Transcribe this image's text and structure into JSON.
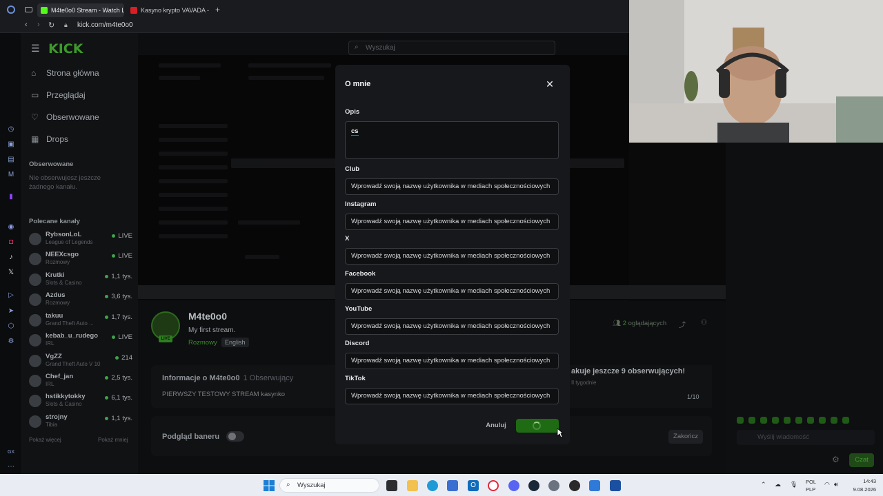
{
  "browser": {
    "tabs": [
      {
        "title": "M4te0o0 Stream - Watch L",
        "active": true,
        "icon_color": "#53fc18"
      },
      {
        "title": "Kasyno krypto VAVADA - i",
        "active": false,
        "icon_color": "#d81f26"
      }
    ],
    "url": "kick.com/m4te0o0"
  },
  "kick": {
    "logo": "KICK",
    "search_placeholder": "Wyszukaj",
    "nav": [
      {
        "label": "Strona główna",
        "icon": "home-icon"
      },
      {
        "label": "Przeglądaj",
        "icon": "browse-icon"
      },
      {
        "label": "Obserwowane",
        "icon": "heart-icon"
      },
      {
        "label": "Drops",
        "icon": "drops-icon"
      }
    ],
    "followed_title": "Obserwowane",
    "followed_empty": "Nie obserwujesz jeszcze żadnego kanału.",
    "recommended_title": "Polecane kanały",
    "recommended": [
      {
        "name": "RybsonLoL",
        "game": "League of Legends",
        "viewers": "LIVE"
      },
      {
        "name": "NEEXcsgo",
        "game": "Rozmowy",
        "viewers": "LIVE"
      },
      {
        "name": "Krutki",
        "game": "Slots & Casino",
        "viewers": "1,1 tys."
      },
      {
        "name": "Azdus",
        "game": "Rozmowy",
        "viewers": "3,6 tys."
      },
      {
        "name": "takuu",
        "game": "Grand Theft Auto ...",
        "viewers": "1,7 tys."
      },
      {
        "name": "kebab_u_rudego",
        "game": "IRL",
        "viewers": "LIVE"
      },
      {
        "name": "VgZZ",
        "game": "Grand Theft Auto V 10",
        "viewers": "214"
      },
      {
        "name": "Chef_jan",
        "game": "IRL",
        "viewers": "2,5 tys."
      },
      {
        "name": "hstikkytokky",
        "game": "Slots & Casino",
        "viewers": "6,1 tys."
      },
      {
        "name": "strojny",
        "game": "Tibia",
        "viewers": "1,1 tys."
      }
    ],
    "show_more": "Pokaż więcej",
    "show_less": "Pokaż mniej",
    "channel": {
      "name": "M4te0o0",
      "title": "My first stream.",
      "category": "Rozmowy",
      "language": "English",
      "live_badge": "LIVE",
      "viewers_count": "2",
      "viewers_label": "oglądających"
    },
    "about": {
      "title": "Informacje o M4te0o0",
      "followers": "1 Obserwujący",
      "description": "PIERWSZY TESTOWY STREAM kasynko"
    },
    "goal": {
      "title": "akuje jeszcze 9 obserwujących!",
      "subtitle": "Il tygodnie",
      "count": "1/10"
    },
    "banner_label": "Podgląd baneru",
    "finish_label": "Zakończ",
    "chat_placeholder": "Wyślij wiadomość",
    "chat_send": "Czat"
  },
  "modal": {
    "title": "O mnie",
    "bio_label": "Opis",
    "bio_value": "cs",
    "social_placeholder": "Wprowadź swoją nazwę użytkownika w mediach społecznościowych",
    "fields": [
      {
        "label": "Club"
      },
      {
        "label": "Instagram"
      },
      {
        "label": "X"
      },
      {
        "label": "Facebook"
      },
      {
        "label": "YouTube"
      },
      {
        "label": "Discord"
      },
      {
        "label": "TikTok"
      }
    ],
    "cancel_label": "Anuluj"
  },
  "taskbar": {
    "search_placeholder": "Wyszukaj",
    "lang_line1": "POL",
    "lang_line2": "PLP",
    "time": "14:43",
    "date": "9.08.2026"
  },
  "colors": {
    "kick_green": "#53fc18",
    "modal_bg": "#17181b",
    "save_button": "#1f6b14"
  }
}
